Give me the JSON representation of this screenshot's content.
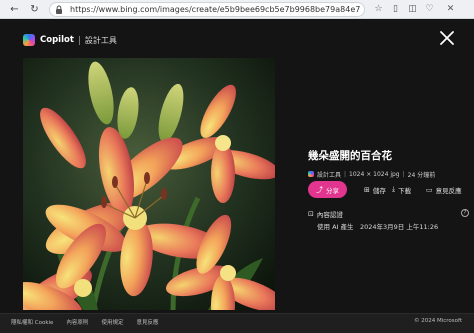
{
  "browser": {
    "url": "https://www.bing.com/images/create/e5b9bee69cb5e7b9968be79a84e799bee…",
    "icons": [
      "back-icon",
      "refresh-icon",
      "lock-icon",
      "favorites-icon",
      "collections-icon",
      "reader-icon",
      "split-screen-icon",
      "close-window-icon"
    ]
  },
  "header": {
    "brand": "Copilot",
    "tool": "設計工具"
  },
  "image": {
    "alt": "幾朵盛開的百合花"
  },
  "details": {
    "title": "幾朵盛開的百合花",
    "meta_tool": "設計工具",
    "resolution": "1024 × 1024 jpg",
    "age": "24 分鐘前"
  },
  "actions": {
    "share": "分享",
    "save": "儲存",
    "download": "下載",
    "feedback": "意見反應"
  },
  "credentials": {
    "label": "內容認證",
    "detail": "使用 AI 產生　2024年3月9日 上午11:26"
  },
  "footer": {
    "links": [
      "隱私權和 Cookie",
      "內容原則",
      "使用規定",
      "意見反應"
    ],
    "copyright": "© 2024 Microsoft"
  },
  "colors": {
    "accent": "#e1358f",
    "background": "#141414"
  }
}
